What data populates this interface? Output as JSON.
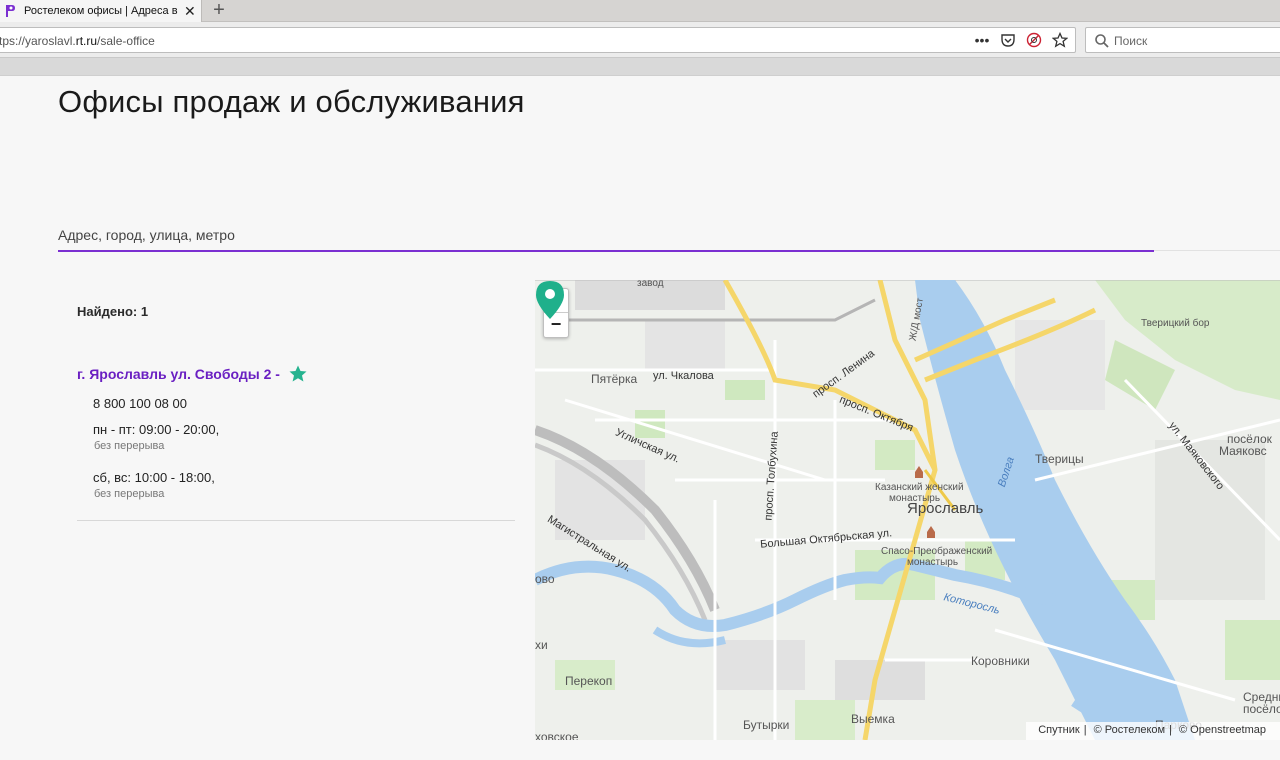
{
  "browser": {
    "tab_title": "Ростелеком офисы | Адреса в г.",
    "url_prefix": "tps://yaroslavl.",
    "url_host": "rt.ru",
    "url_path": "/sale-office",
    "search_placeholder": "Поиск",
    "icons": [
      "menu-dots-icon",
      "pocket-icon",
      "no-tracking-icon",
      "bookmark-star-icon",
      "search-icon"
    ]
  },
  "page": {
    "title": "Офисы продаж и обслуживания",
    "search_placeholder": "Адрес, город, улица, метро",
    "found_label": "Найдено: 1"
  },
  "office": {
    "name": "г. Ярославль ул. Свободы 2 -",
    "phone": "8 800 100 08 00",
    "hours_weekdays": "пн - пт: 09:00 - 20:00,",
    "note_weekdays": "без перерыва",
    "hours_weekend": "сб, вс: 10:00 - 18:00,",
    "note_weekend": "без перерыва",
    "accent": "#6a1fc2",
    "star_color": "#26b38f"
  },
  "map": {
    "zoom_in": "+",
    "zoom_out": "−",
    "labels": {
      "pyaterka": "Пятёрка",
      "chkalova": "ул. Чкалова",
      "lenina": "просп. Ленина",
      "oktyabrya": "просп. Октября",
      "uglichskaya": "Угличская ул.",
      "tolbukhina": "просп. Толбухина",
      "kazan_1": "Казанский женский",
      "kazan_2": "монастырь",
      "yaroslavl": "Ярославль",
      "bolshaya": "Большая Октябрьская ул.",
      "spaso_1": "Спасо-Преображенский",
      "spaso_2": "монастырь",
      "magistral": "Магистральная ул.",
      "volga": "Волга",
      "tveritsy": "Тверицы",
      "tveritsky_bor": "Тверицкий бор",
      "mayakovskogo": "ул. Маяковского",
      "poselok_1": "посёлок",
      "poselok_2": "Маяковс",
      "kotorosl": "Которосль",
      "korovniki": "Коровники",
      "perekop": "Перекоп",
      "butyrki": "Бутырки",
      "vyemka": "Выемка",
      "parkovo": "Парково",
      "sredni_1": "Средни",
      "sredni_2": "посёлок",
      "ovo": "ово",
      "khi": "хи",
      "khovskoe": "ховское",
      "zavod": "завод",
      "bridge": "Ж/Д мост"
    },
    "attribution": [
      "Спутник",
      "© Ростелеком",
      "© Openstreetmap"
    ]
  }
}
